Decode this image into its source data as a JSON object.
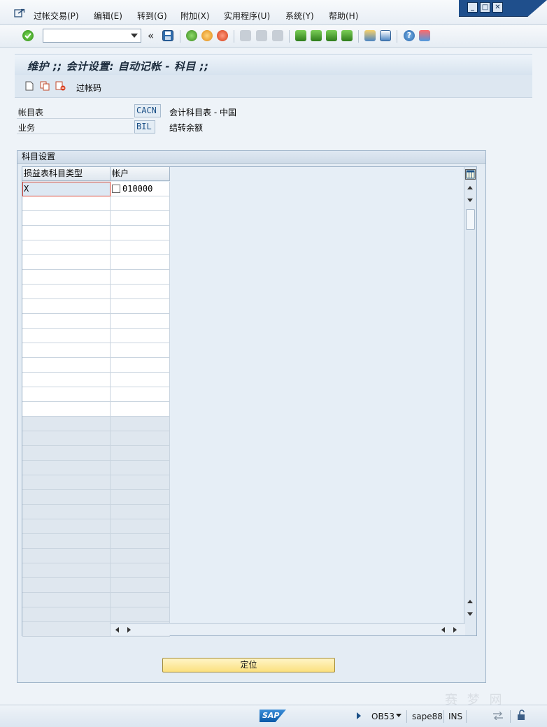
{
  "menubar": {
    "items": [
      "过帐交易(P)",
      "编辑(E)",
      "转到(G)",
      "附加(X)",
      "实用程序(U)",
      "系统(Y)",
      "帮助(H)"
    ]
  },
  "window_controls": {
    "minimize": "_",
    "restore": "□",
    "close": "✕"
  },
  "toolbar": {
    "command_value": "",
    "history_back": "«"
  },
  "page": {
    "title": "维护 ;; 会计设置: 自动记帐 - 科目 ;;"
  },
  "app_toolbar": {
    "posting_key_label": "过帐码"
  },
  "header_fields": {
    "chart_of_accounts": {
      "label": "帐目表",
      "value": "CACN",
      "description": "会计科目表 - 中国"
    },
    "transaction": {
      "label": "业务",
      "value": "BIL",
      "description": "结转余额"
    }
  },
  "group": {
    "title": "科目设置"
  },
  "table": {
    "columns": [
      "损益表科目类型",
      "帐户"
    ],
    "rows": [
      {
        "type": "X",
        "account": "010000"
      }
    ]
  },
  "buttons": {
    "locate": "定位"
  },
  "statusbar": {
    "sap_logo": "SAP",
    "transaction_code": "OB53",
    "server": "sape88",
    "mode": "INS"
  },
  "watermark": "赛 梦 网",
  "colors": {
    "accent": "#1f4f8c",
    "button": "#fbe07e",
    "field_text": "#1a4f86"
  }
}
